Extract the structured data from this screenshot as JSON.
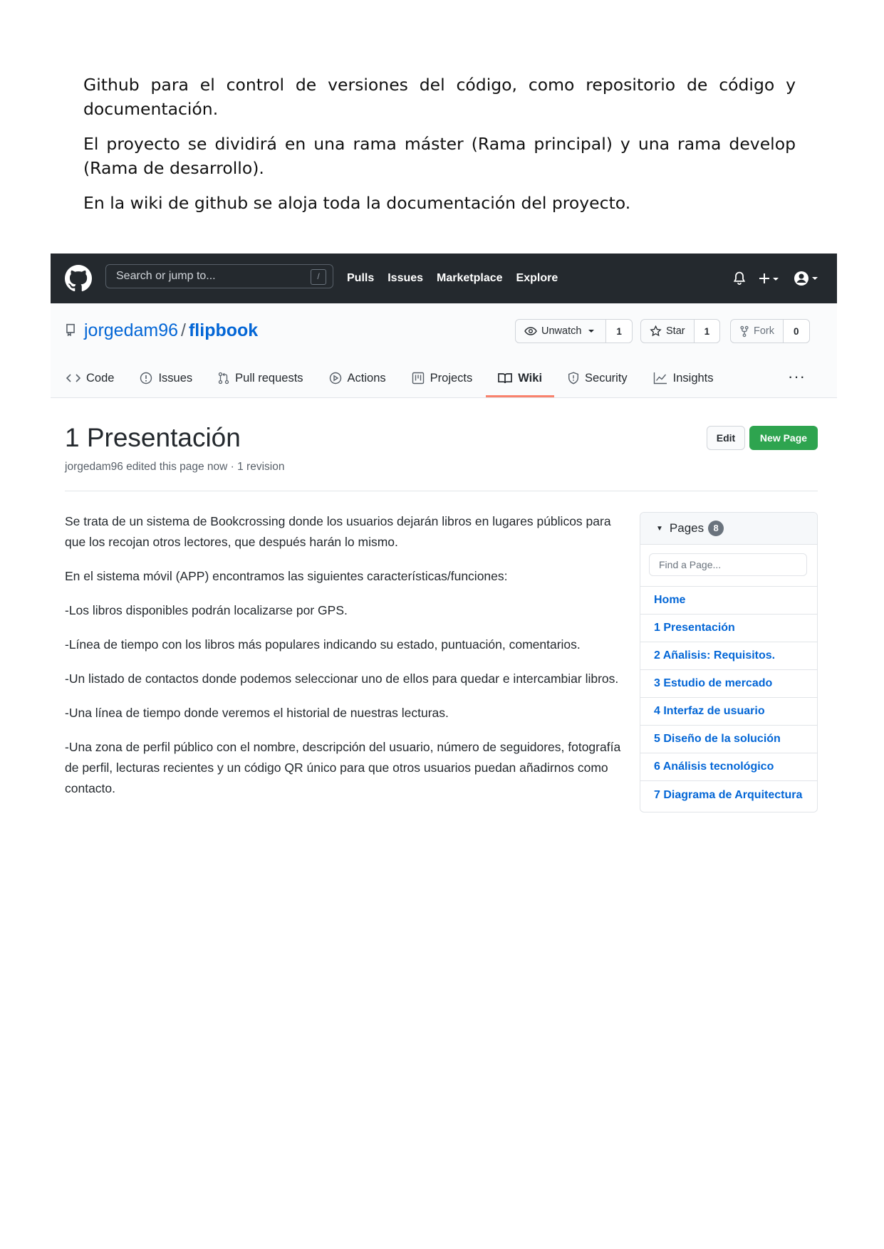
{
  "doc": {
    "paragraphs": [
      "Github para el control de versiones del código, como repositorio de código y documentación.",
      "El proyecto se dividirá en una rama máster (Rama principal) y una rama develop (Rama de desarrollo).",
      "En la wiki de github se aloja toda la documentación del proyecto."
    ]
  },
  "topbar": {
    "search_placeholder": "Search or jump to...",
    "search_shortcut": "/",
    "nav": [
      "Pulls",
      "Issues",
      "Marketplace",
      "Explore"
    ]
  },
  "repo": {
    "owner": "jorgedam96",
    "separator": "/",
    "name": "flipbook",
    "unwatch_label": "Unwatch",
    "unwatch_count": "1",
    "star_label": "Star",
    "star_count": "1",
    "fork_label": "Fork",
    "fork_count": "0"
  },
  "tabs": [
    {
      "label": "Code",
      "icon": "code-icon"
    },
    {
      "label": "Issues",
      "icon": "issue-icon"
    },
    {
      "label": "Pull requests",
      "icon": "pull-request-icon"
    },
    {
      "label": "Actions",
      "icon": "play-icon"
    },
    {
      "label": "Projects",
      "icon": "project-icon"
    },
    {
      "label": "Wiki",
      "icon": "book-icon",
      "active": true
    },
    {
      "label": "Security",
      "icon": "shield-icon"
    },
    {
      "label": "Insights",
      "icon": "graph-icon"
    }
  ],
  "tabs_more": "···",
  "wiki": {
    "title": "1 Presentación",
    "meta": "jorgedam96 edited this page now · 1 revision",
    "edit_label": "Edit",
    "new_page_label": "New Page",
    "body": [
      "Se trata de un sistema de Bookcrossing donde los usuarios dejarán libros en lugares públicos para que los recojan otros lectores, que después harán lo mismo.",
      "En el sistema móvil (APP) encontramos las siguientes características/funciones:",
      "-Los libros disponibles podrán localizarse por GPS.",
      "-Línea de tiempo con los libros más populares indicando su estado, puntuación, comentarios.",
      "-Un listado de contactos donde podemos seleccionar uno de ellos para quedar e intercambiar libros.",
      "-Una línea de tiempo donde veremos el historial de nuestras lecturas.",
      "-Una zona de perfil público con el nombre, descripción del usuario, número de seguidores, fotografía de perfil, lecturas recientes y un código QR único para que otros usuarios puedan añadirnos como contacto."
    ]
  },
  "sidebar": {
    "pages_label": "Pages",
    "pages_count": "8",
    "find_placeholder": "Find a Page...",
    "pages": [
      "Home",
      "1 Presentación",
      "2 Añalisis: Requisitos.",
      "3 Estudio de mercado",
      "4 Interfaz de usuario",
      "5 Diseño de la solución",
      "6 Análisis tecnológico",
      "7 Diagrama de Arquitectura"
    ]
  },
  "colors": {
    "topbar": "#24292e",
    "link": "#0366d6",
    "new_page": "#2ea44f",
    "active_tab_underline": "#f9826c"
  }
}
